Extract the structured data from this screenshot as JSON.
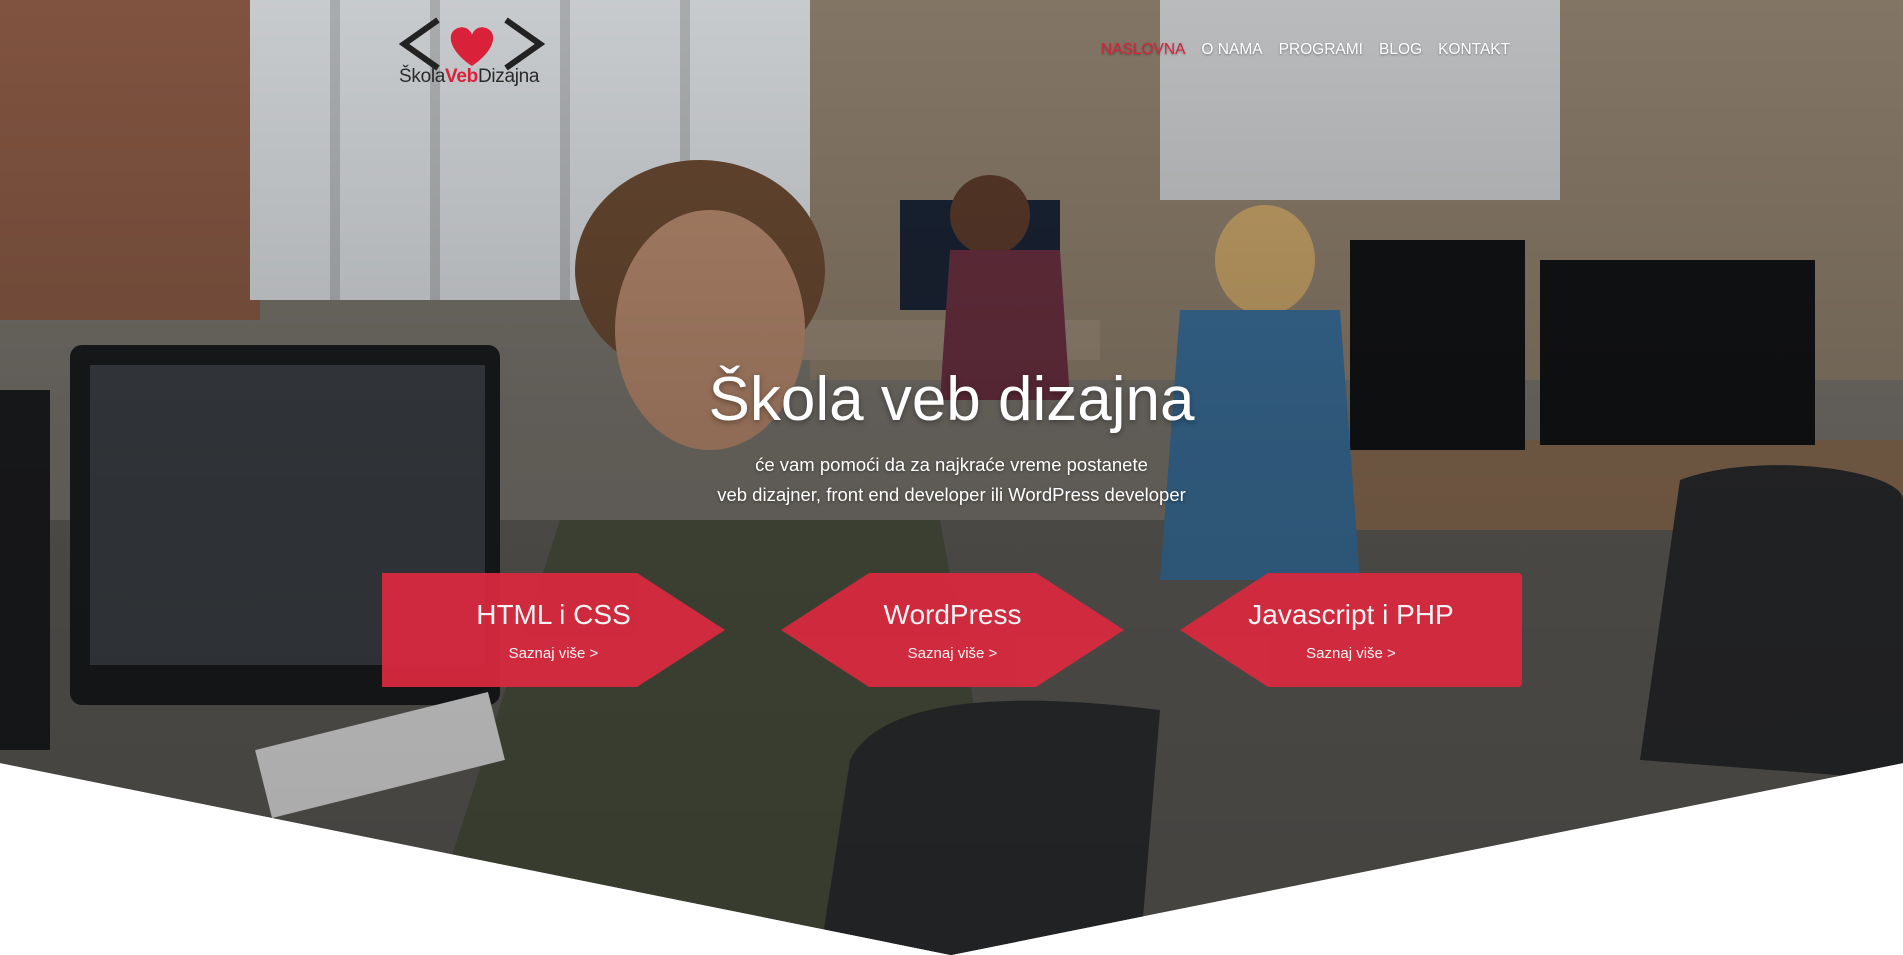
{
  "logo": {
    "text_part1": "Škola",
    "text_part2": "Veb",
    "text_part3": "Dizajna",
    "icon": "code-brackets-heart-logo",
    "heart_color": "#d9223a"
  },
  "nav": {
    "items": [
      {
        "label": "NASLOVNA",
        "active": true
      },
      {
        "label": "O NAMA",
        "active": false
      },
      {
        "label": "PROGRAMI",
        "active": false
      },
      {
        "label": "BLOG",
        "active": false
      },
      {
        "label": "KONTAKT",
        "active": false
      }
    ]
  },
  "hero": {
    "title": "Škola veb dizajna",
    "subtitle_line1": "će vam pomoći da za najkraće vreme postanete",
    "subtitle_line2": "veb dizajner, front end developer ili WordPress developer"
  },
  "programs": [
    {
      "title": "HTML i CSS",
      "link": "Saznaj više >"
    },
    {
      "title": "WordPress",
      "link": "Saznaj više >"
    },
    {
      "title": "Javascript i PHP",
      "link": "Saznaj više >"
    }
  ],
  "colors": {
    "accent": "#d9223a",
    "card": "#d9293f",
    "text_on_hero": "#ffffff"
  }
}
